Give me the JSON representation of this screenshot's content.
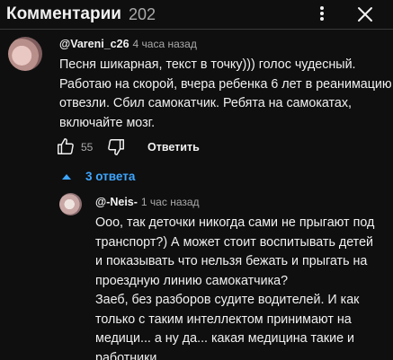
{
  "header": {
    "title": "Комментарии",
    "count": "202",
    "icons": {
      "menu": "more-vert-icon",
      "close": "close-icon"
    }
  },
  "comment": {
    "author": "@Vareni_c26",
    "time": "4 часа назад",
    "lines": [
      "Песня шикарная, текст в точку))) голос чудесный.",
      "Работаю на скорой, вчера ребенка 6 лет в реанимацию",
      "отвезли. Сбил самокатчик. Ребята на самокатах,",
      "включайте мозг."
    ],
    "likes": "55",
    "reply_label": "Ответить"
  },
  "replies": {
    "toggle_label": "3 ответа",
    "accent": "#3ea6ff"
  },
  "reply": {
    "author": "@-Neis-",
    "time": "1 час назад",
    "lines": [
      "Ооо, так деточки никогда сами не прыгают под",
      "транспорт?) А может стоит воспитывать детей",
      "и показывать что нельзя бежать и прыгать на",
      "проездную линию самокатчика?",
      "Заеб, без разборов судите водителей. И как",
      "только с таким интеллектом принимают на",
      "медици... а ну да... какая медицина такие и",
      "работники."
    ]
  }
}
